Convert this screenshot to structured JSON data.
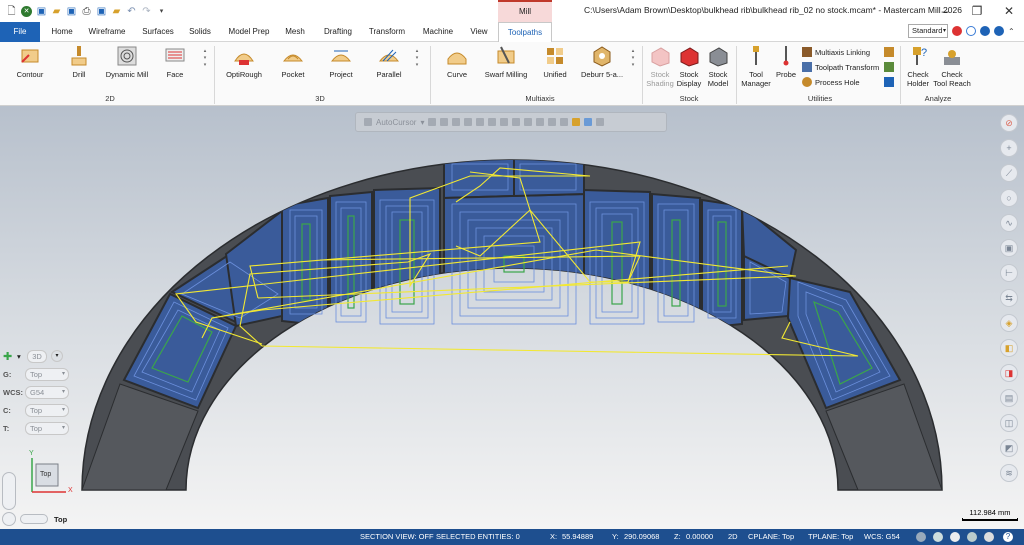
{
  "titlebar": {
    "context_tab": "Mill",
    "window_title": "C:\\Users\\Adam Brown\\Desktop\\bulkhead rib\\bulkhead rib_02 no stock.mcam* - Mastercam Mill 2026",
    "controls": [
      "minimize-icon",
      "restore-icon",
      "close-icon"
    ]
  },
  "tabs": {
    "file": "File",
    "items": [
      "Home",
      "Wireframe",
      "Surfaces",
      "Solids",
      "Model Prep",
      "Mesh",
      "Drafting",
      "Transform",
      "Machine",
      "View",
      "Toolpaths"
    ],
    "active": "Toolpaths",
    "workspace": "Standard"
  },
  "ribbon": {
    "groups": {
      "g2d": "2D",
      "g3d": "3D",
      "multiaxis": "Multiaxis",
      "stock": "Stock",
      "utilities": "Utilities",
      "analyze": "Analyze"
    },
    "buttons_2d": [
      "Contour",
      "Drill",
      "Dynamic Mill",
      "Face"
    ],
    "buttons_3d": [
      "OptiRough",
      "Pocket",
      "Project",
      "Parallel"
    ],
    "buttons_multiaxis": [
      "Curve",
      "Swarf Milling",
      "Unified",
      "Deburr 5-a..."
    ],
    "stock": {
      "shading_1": "Stock",
      "shading_2": "Shading",
      "display_1": "Stock",
      "display_2": "Display",
      "model_1": "Stock",
      "model_2": "Model"
    },
    "utilities": {
      "tool_manager_1": "Tool",
      "tool_manager_2": "Manager",
      "probe": "Probe",
      "multiaxis_linking": "Multiaxis Linking",
      "toolpath_transform": "Toolpath Transform",
      "process_hole": "Process Hole"
    },
    "analyze": {
      "check_holder_1": "Check",
      "check_holder_2": "Holder",
      "check_reach_1": "Check",
      "check_reach_2": "Tool Reach"
    }
  },
  "viewport": {
    "autocursor_label": "AutoCursor",
    "mode_3d": "3D",
    "planes": [
      {
        "key": "G:",
        "value": "Top"
      },
      {
        "key": "WCS:",
        "value": "G54"
      },
      {
        "key": "C:",
        "value": "Top"
      },
      {
        "key": "T:",
        "value": "Top"
      }
    ],
    "view_name": "Top",
    "gnomon_label": "Top",
    "axis_x": "X",
    "axis_y": "Y",
    "scale": "112.984 mm"
  },
  "statusbar": {
    "section_view": "SECTION VIEW: OFF",
    "selected_entities": "SELECTED ENTITIES: 0",
    "x_label": "X:",
    "x_value": "55.94889",
    "y_label": "Y:",
    "y_value": "290.09068",
    "z_label": "Z:",
    "z_value": "0.00000",
    "mode": "2D",
    "cplane": "CPLANE: Top",
    "tplane": "TPLANE: Top",
    "wcs": "WCS: G54"
  },
  "colors": {
    "accent": "#1e63b6",
    "status_bar": "#1e4f8f",
    "part_fill": "#4a4d52",
    "toolpath_blue": "#3f6fc6",
    "toolpath_green": "#3aa64a",
    "rapid_yellow": "#f2e833"
  }
}
